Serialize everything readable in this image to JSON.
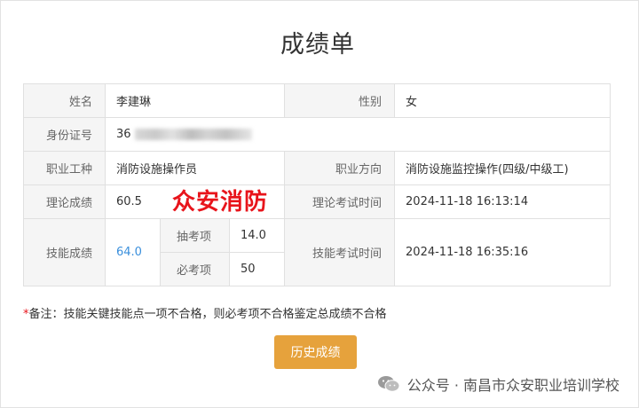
{
  "title": "成绩单",
  "fields": {
    "name": {
      "label": "姓名",
      "value": "李建琳"
    },
    "gender": {
      "label": "性别",
      "value": "女"
    },
    "id_number": {
      "label": "身份证号",
      "value_visible": "36"
    },
    "occupation": {
      "label": "职业工种",
      "value": "消防设施操作员"
    },
    "direction": {
      "label": "职业方向",
      "value": "消防设施监控操作(四级/中级工)"
    },
    "theory_score": {
      "label": "理论成绩",
      "value": "60.5"
    },
    "theory_time": {
      "label": "理论考试时间",
      "value": "2024-11-18 16:13:14"
    },
    "skill_score": {
      "label": "技能成绩",
      "value": "64.0"
    },
    "sample_item": {
      "label": "抽考项",
      "value": "14.0"
    },
    "required_item": {
      "label": "必考项",
      "value": "50"
    },
    "skill_time": {
      "label": "技能考试时间",
      "value": "2024-11-18 16:35:16"
    }
  },
  "watermark": "众安消防",
  "note": {
    "star": "*",
    "text": "备注：技能关键技能点一项不合格，则必考项不合格鉴定总成绩不合格"
  },
  "history_button": "历史成绩",
  "footer": "公众号 · 南昌市众安职业培训学校",
  "colors": {
    "accent_button": "#e6a23c",
    "link_blue": "#3a8fdc",
    "red": "#e8141b",
    "label_bg": "#f5f5f5"
  }
}
